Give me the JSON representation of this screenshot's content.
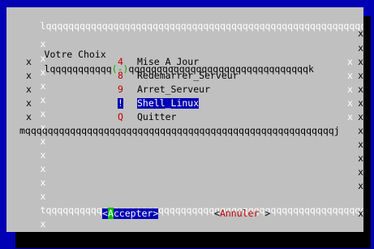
{
  "dialog": {
    "title": "Votre Choix",
    "frame": {
      "top": "lqqqqqqqqqqqqqqqqqqqqqqqqqqqqqqqqqqqqqqqqqqqqqqqqqqqqqqqqqqqqk",
      "inner_top_left": "lqqqqqqqqqqq",
      "inner_top_mark": "(-)",
      "inner_top_right": "qqqqqqqqqqqqqqqqqqqqqqqqqqqqqqqqk",
      "inner_bottom": "mqqqqqqqqqqqqqqqqqqqqqqqqqqqqqqqqqqqqqqqqqqqqqqqqqqqqqqqj",
      "separator": "tqqqqqqqqqqqqqqqqqqqqqqqqqqqqqqqqqqqqqqqqqqqqqqqqqqqqqqqqqqqqu",
      "bottom": "mqqqqqqqqqqqqqqqqqqqqqqqqqqqqqqqqqqqqqqqqqqqqqqqqqqqqqqqqqqqqj",
      "side": "x"
    },
    "menu_items": [
      {
        "tag": "4",
        "label": "Mise_A_Jour",
        "selected": false
      },
      {
        "tag": "8",
        "label": "Redemarrer_Serveur",
        "selected": false
      },
      {
        "tag": "9",
        "label": "Arret_Serveur",
        "selected": false
      },
      {
        "tag": "!",
        "label": "Shell_Linux",
        "selected": true
      },
      {
        "tag": "Q",
        "label": "Quitter",
        "selected": false
      }
    ],
    "buttons": {
      "accept": {
        "open": "<",
        "hotkey": "A",
        "rest": "ccepter",
        "close": ">"
      },
      "cancel": {
        "open": "<",
        "hotkey": "A",
        "rest": "nnuler",
        "close": " >"
      }
    }
  },
  "colors": {
    "background": "#0000b4",
    "dialog": "#c0c0c0",
    "highlight": "#0000b4",
    "hotkey": "#c00000",
    "button_hotkey": "#00c000"
  }
}
